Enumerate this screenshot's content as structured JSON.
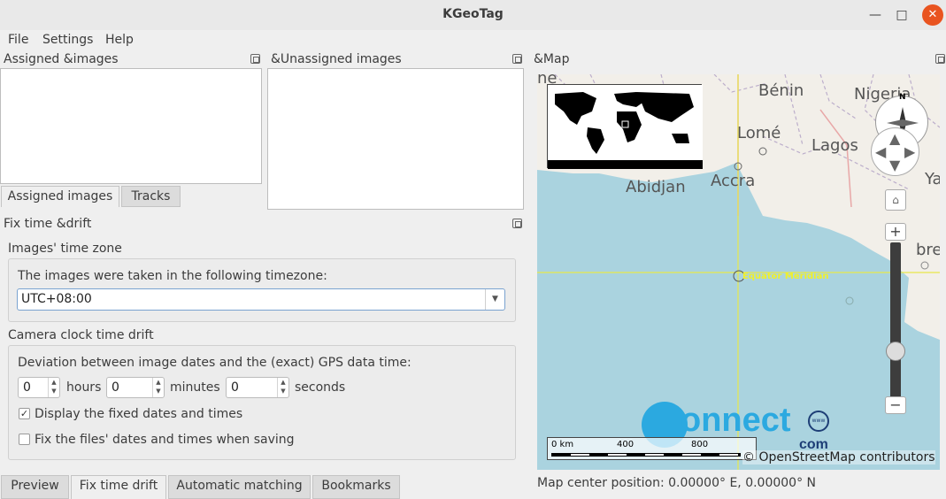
{
  "window": {
    "title": "KGeoTag",
    "minimize_glyph": "—",
    "maximize_glyph": "□",
    "close_glyph": "✕"
  },
  "menu": {
    "file": "File",
    "settings": "Settings",
    "help": "Help"
  },
  "assigned_dock": {
    "title": "Assigned &images"
  },
  "unassigned_dock": {
    "title": "&Unassigned images"
  },
  "left_tabs": {
    "assigned": "Assigned images",
    "tracks": "Tracks"
  },
  "fix_drift": {
    "title": "Fix time &drift",
    "tz_group_title": "Images' time zone",
    "tz_label": "The images were taken in the following timezone:",
    "tz_value": "UTC+08:00",
    "drift_group_title": "Camera clock time drift",
    "deviation_label": "Deviation between image dates and the (exact) GPS data time:",
    "hours_value": "0",
    "hours_label": "hours",
    "minutes_value": "0",
    "minutes_label": "minutes",
    "seconds_value": "0",
    "seconds_label": "seconds",
    "display_fixed_label": "Display the fixed dates and times",
    "display_fixed_checked": true,
    "fix_files_label": "Fix the files' dates and times when saving",
    "fix_files_checked": false
  },
  "bottom_tabs": {
    "preview": "Preview",
    "fix_drift": "Fix time drift",
    "auto_match": "Automatic matching",
    "bookmarks": "Bookmarks"
  },
  "map": {
    "title": "&Map",
    "places": {
      "benin": "Bénin",
      "nigeria": "Nigeria",
      "lome": "Lomé",
      "lagos": "Lagos",
      "abidjan": "Abidjan",
      "accra": "Accra",
      "ya": "Ya",
      "ne": "ne",
      "ibrev": "brev"
    },
    "crosshair_label": "Equator Meridian",
    "compass_north": "N",
    "scale": {
      "zero": "0 km",
      "mid": "400",
      "end": "800"
    },
    "attribution": "© OpenStreetMap contributors",
    "watermark_text": "onnect",
    "watermark_com": "com",
    "watermark_www": "www",
    "zoom_level": 0.27
  },
  "status": {
    "center": "Map center position: 0.00000° E, 0.00000° N"
  }
}
